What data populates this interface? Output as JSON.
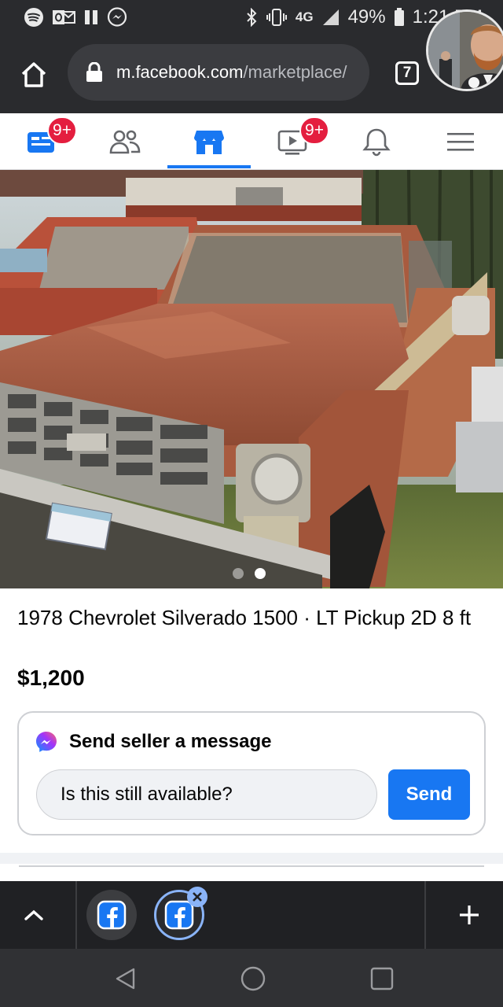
{
  "status_bar": {
    "battery": "49%",
    "time": "1:21 PM",
    "network": "4G",
    "left_icons": [
      "spotify-icon",
      "outlook-icon",
      "pause-icon",
      "messenger-icon"
    ],
    "right_icons": [
      "bluetooth-icon",
      "vibrate-icon",
      "signal-icon",
      "battery-icon"
    ]
  },
  "browser": {
    "url_domain": "m.facebook.com",
    "url_path": "/marketplace/",
    "tab_count": "7"
  },
  "fb_nav": {
    "items": [
      {
        "name": "news-feed",
        "badge": "9+"
      },
      {
        "name": "friends",
        "badge": ""
      },
      {
        "name": "marketplace",
        "badge": "",
        "active": true
      },
      {
        "name": "watch",
        "badge": "9+"
      },
      {
        "name": "notifications",
        "badge": ""
      },
      {
        "name": "menu",
        "badge": ""
      }
    ]
  },
  "listing": {
    "title": "1978 Chevrolet Silverado 1500 · LT Pickup 2D 8 ft",
    "price": "$1,200",
    "photo_count": 2,
    "photo_active_index": 1
  },
  "message": {
    "header": "Send seller a message",
    "input_value": "Is this still available?",
    "send_label": "Send"
  },
  "colors": {
    "fb_blue": "#1877f2",
    "badge_red": "#e41e3f",
    "chrome_dark": "#2a2b2e"
  }
}
